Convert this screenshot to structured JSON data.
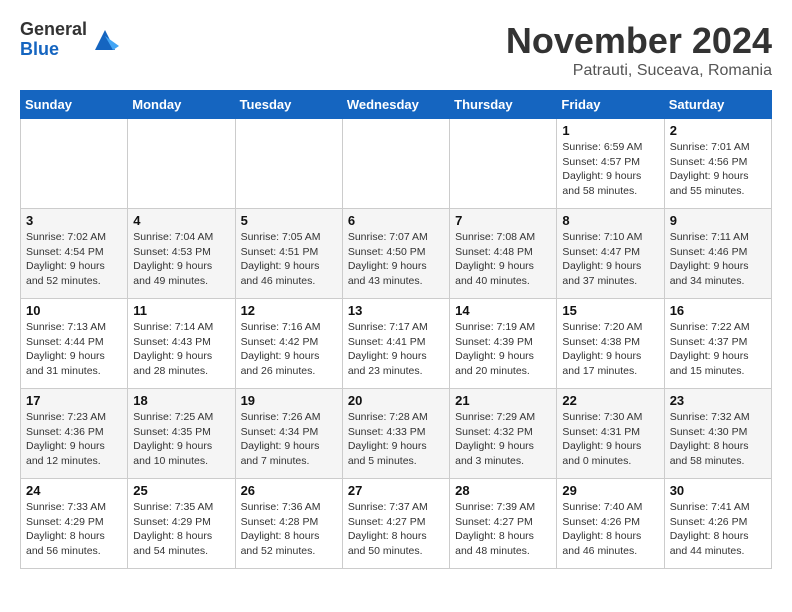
{
  "logo": {
    "general": "General",
    "blue": "Blue"
  },
  "title": "November 2024",
  "location": "Patrauti, Suceava, Romania",
  "days_of_week": [
    "Sunday",
    "Monday",
    "Tuesday",
    "Wednesday",
    "Thursday",
    "Friday",
    "Saturday"
  ],
  "weeks": [
    [
      {
        "day": "",
        "info": ""
      },
      {
        "day": "",
        "info": ""
      },
      {
        "day": "",
        "info": ""
      },
      {
        "day": "",
        "info": ""
      },
      {
        "day": "",
        "info": ""
      },
      {
        "day": "1",
        "info": "Sunrise: 6:59 AM\nSunset: 4:57 PM\nDaylight: 9 hours and 58 minutes."
      },
      {
        "day": "2",
        "info": "Sunrise: 7:01 AM\nSunset: 4:56 PM\nDaylight: 9 hours and 55 minutes."
      }
    ],
    [
      {
        "day": "3",
        "info": "Sunrise: 7:02 AM\nSunset: 4:54 PM\nDaylight: 9 hours and 52 minutes."
      },
      {
        "day": "4",
        "info": "Sunrise: 7:04 AM\nSunset: 4:53 PM\nDaylight: 9 hours and 49 minutes."
      },
      {
        "day": "5",
        "info": "Sunrise: 7:05 AM\nSunset: 4:51 PM\nDaylight: 9 hours and 46 minutes."
      },
      {
        "day": "6",
        "info": "Sunrise: 7:07 AM\nSunset: 4:50 PM\nDaylight: 9 hours and 43 minutes."
      },
      {
        "day": "7",
        "info": "Sunrise: 7:08 AM\nSunset: 4:48 PM\nDaylight: 9 hours and 40 minutes."
      },
      {
        "day": "8",
        "info": "Sunrise: 7:10 AM\nSunset: 4:47 PM\nDaylight: 9 hours and 37 minutes."
      },
      {
        "day": "9",
        "info": "Sunrise: 7:11 AM\nSunset: 4:46 PM\nDaylight: 9 hours and 34 minutes."
      }
    ],
    [
      {
        "day": "10",
        "info": "Sunrise: 7:13 AM\nSunset: 4:44 PM\nDaylight: 9 hours and 31 minutes."
      },
      {
        "day": "11",
        "info": "Sunrise: 7:14 AM\nSunset: 4:43 PM\nDaylight: 9 hours and 28 minutes."
      },
      {
        "day": "12",
        "info": "Sunrise: 7:16 AM\nSunset: 4:42 PM\nDaylight: 9 hours and 26 minutes."
      },
      {
        "day": "13",
        "info": "Sunrise: 7:17 AM\nSunset: 4:41 PM\nDaylight: 9 hours and 23 minutes."
      },
      {
        "day": "14",
        "info": "Sunrise: 7:19 AM\nSunset: 4:39 PM\nDaylight: 9 hours and 20 minutes."
      },
      {
        "day": "15",
        "info": "Sunrise: 7:20 AM\nSunset: 4:38 PM\nDaylight: 9 hours and 17 minutes."
      },
      {
        "day": "16",
        "info": "Sunrise: 7:22 AM\nSunset: 4:37 PM\nDaylight: 9 hours and 15 minutes."
      }
    ],
    [
      {
        "day": "17",
        "info": "Sunrise: 7:23 AM\nSunset: 4:36 PM\nDaylight: 9 hours and 12 minutes."
      },
      {
        "day": "18",
        "info": "Sunrise: 7:25 AM\nSunset: 4:35 PM\nDaylight: 9 hours and 10 minutes."
      },
      {
        "day": "19",
        "info": "Sunrise: 7:26 AM\nSunset: 4:34 PM\nDaylight: 9 hours and 7 minutes."
      },
      {
        "day": "20",
        "info": "Sunrise: 7:28 AM\nSunset: 4:33 PM\nDaylight: 9 hours and 5 minutes."
      },
      {
        "day": "21",
        "info": "Sunrise: 7:29 AM\nSunset: 4:32 PM\nDaylight: 9 hours and 3 minutes."
      },
      {
        "day": "22",
        "info": "Sunrise: 7:30 AM\nSunset: 4:31 PM\nDaylight: 9 hours and 0 minutes."
      },
      {
        "day": "23",
        "info": "Sunrise: 7:32 AM\nSunset: 4:30 PM\nDaylight: 8 hours and 58 minutes."
      }
    ],
    [
      {
        "day": "24",
        "info": "Sunrise: 7:33 AM\nSunset: 4:29 PM\nDaylight: 8 hours and 56 minutes."
      },
      {
        "day": "25",
        "info": "Sunrise: 7:35 AM\nSunset: 4:29 PM\nDaylight: 8 hours and 54 minutes."
      },
      {
        "day": "26",
        "info": "Sunrise: 7:36 AM\nSunset: 4:28 PM\nDaylight: 8 hours and 52 minutes."
      },
      {
        "day": "27",
        "info": "Sunrise: 7:37 AM\nSunset: 4:27 PM\nDaylight: 8 hours and 50 minutes."
      },
      {
        "day": "28",
        "info": "Sunrise: 7:39 AM\nSunset: 4:27 PM\nDaylight: 8 hours and 48 minutes."
      },
      {
        "day": "29",
        "info": "Sunrise: 7:40 AM\nSunset: 4:26 PM\nDaylight: 8 hours and 46 minutes."
      },
      {
        "day": "30",
        "info": "Sunrise: 7:41 AM\nSunset: 4:26 PM\nDaylight: 8 hours and 44 minutes."
      }
    ]
  ]
}
